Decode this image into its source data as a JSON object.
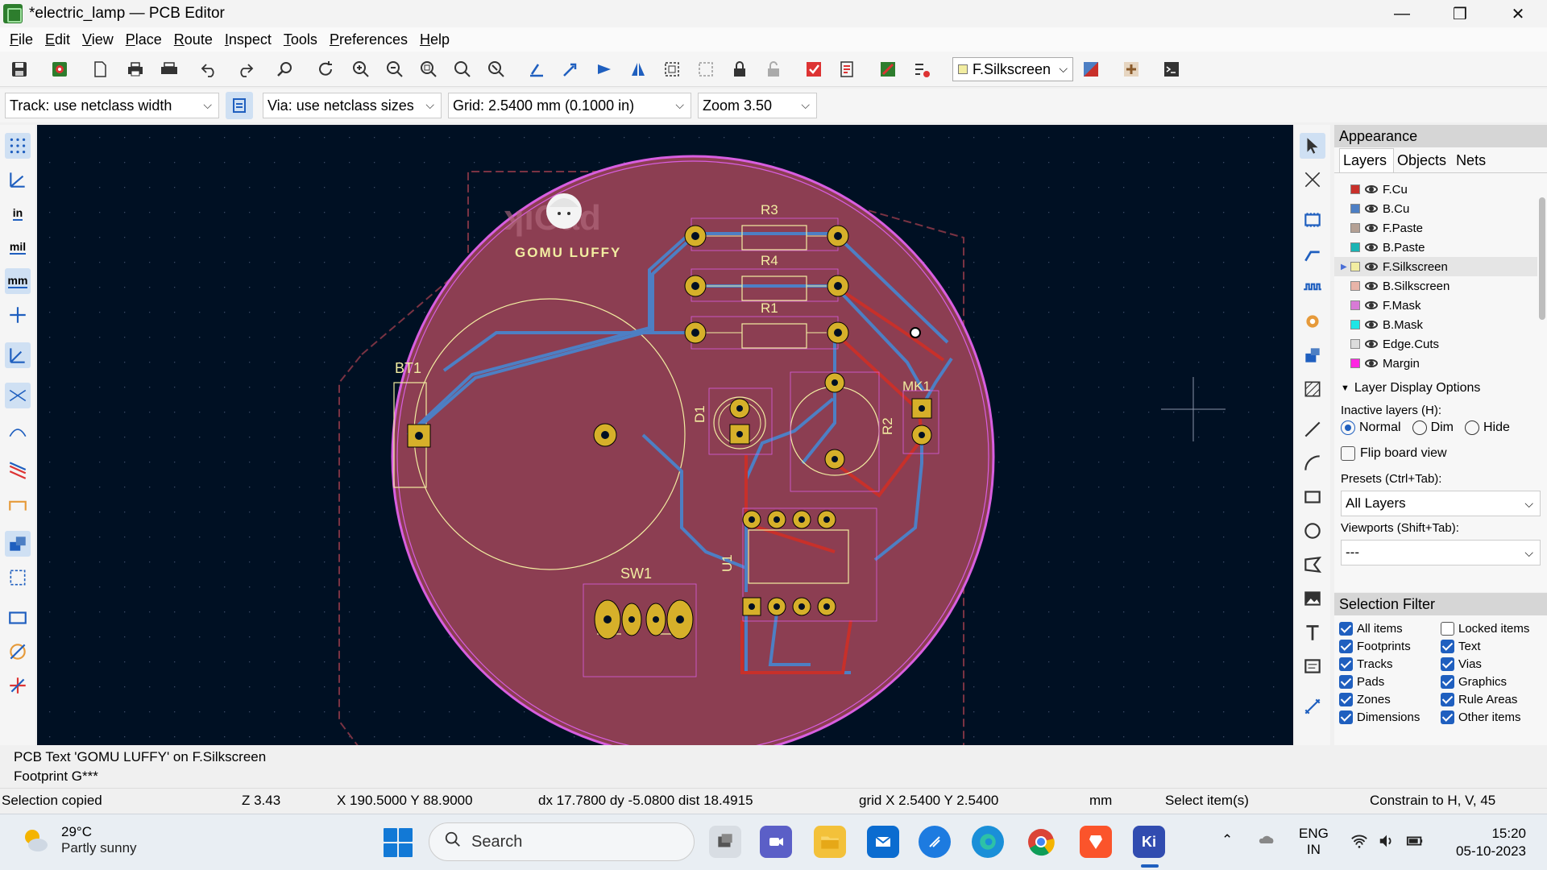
{
  "window": {
    "title": "*electric_lamp — PCB Editor",
    "minimize": "—",
    "maximize": "❒",
    "close": "✕"
  },
  "menu": [
    "File",
    "Edit",
    "View",
    "Place",
    "Route",
    "Inspect",
    "Tools",
    "Preferences",
    "Help"
  ],
  "toolbar": {
    "active_layer": "F.Silkscreen",
    "active_layer_color": "#f2eda1"
  },
  "toolbar2": {
    "track": "Track: use netclass width",
    "via": "Via: use netclass sizes",
    "grid": "Grid: 2.5400 mm (0.1000 in)",
    "zoom": "Zoom 3.50"
  },
  "left_toolbar": {
    "units_in": "in",
    "units_mil": "mil",
    "units_mm": "mm"
  },
  "board": {
    "refs": {
      "r3": "R3",
      "r4": "R4",
      "r1": "R1",
      "bt1": "BT1",
      "mk1": "MK1",
      "d1": "D1",
      "r2": "R2",
      "u1": "U1",
      "sw1": "SW1"
    },
    "logo_text": "GOMU LUFFY",
    "colors": {
      "background": "#001023",
      "fill_zone": "#8c3e52",
      "edge": "#d85ee0",
      "front_copper": "#c8302a",
      "back_copper": "#4d7fc4",
      "pad": "#d6b02a",
      "silkscreen": "#f2eda1"
    }
  },
  "appearance": {
    "header": "Appearance",
    "tabs": [
      "Layers",
      "Objects",
      "Nets"
    ],
    "layers": [
      {
        "name": "F.Cu",
        "color": "#c8302a"
      },
      {
        "name": "B.Cu",
        "color": "#4d7fc4"
      },
      {
        "name": "F.Paste",
        "color": "#b4a094"
      },
      {
        "name": "B.Paste",
        "color": "#1ab4b4"
      },
      {
        "name": "F.Silkscreen",
        "color": "#f2eda1"
      },
      {
        "name": "B.Silkscreen",
        "color": "#e8b4a8"
      },
      {
        "name": "F.Mask",
        "color": "#d87ad6"
      },
      {
        "name": "B.Mask",
        "color": "#1ee6e6"
      },
      {
        "name": "Edge.Cuts",
        "color": "#dcdcdc"
      },
      {
        "name": "Margin",
        "color": "#ff26e2"
      }
    ],
    "display_options_title": "Layer Display Options",
    "inactive_label": "Inactive layers (H):",
    "inactive_options": [
      "Normal",
      "Dim",
      "Hide"
    ],
    "flip_board": "Flip board view",
    "presets_label": "Presets (Ctrl+Tab):",
    "presets_value": "All Layers",
    "viewports_label": "Viewports (Shift+Tab):",
    "viewports_value": "---"
  },
  "selection_filter": {
    "header": "Selection Filter",
    "items": [
      {
        "label": "All items",
        "checked": true
      },
      {
        "label": "Locked items",
        "checked": false
      },
      {
        "label": "Footprints",
        "checked": true
      },
      {
        "label": "Text",
        "checked": true
      },
      {
        "label": "Tracks",
        "checked": true
      },
      {
        "label": "Vias",
        "checked": true
      },
      {
        "label": "Pads",
        "checked": true
      },
      {
        "label": "Graphics",
        "checked": true
      },
      {
        "label": "Zones",
        "checked": true
      },
      {
        "label": "Rule Areas",
        "checked": true
      },
      {
        "label": "Dimensions",
        "checked": true
      },
      {
        "label": "Other items",
        "checked": true
      }
    ]
  },
  "message": {
    "line1": "PCB Text 'GOMU LUFFY' on F.Silkscreen",
    "line2": "Footprint G***"
  },
  "status": {
    "msg": "Selection copied",
    "zoom": "Z 3.43",
    "xy": "X 190.5000  Y 88.9000",
    "delta": "dx 17.7800  dy -5.0800  dist 18.4915",
    "grid": "grid X 2.5400  Y 2.5400",
    "units": "mm",
    "tool": "Select item(s)",
    "constrain": "Constrain to H, V, 45"
  },
  "taskbar": {
    "temp": "29°C",
    "weather": "Partly sunny",
    "search": "Search",
    "lang1": "ENG",
    "lang2": "IN",
    "time": "15:20",
    "date": "05-10-2023",
    "kicad_label": "Ki"
  }
}
